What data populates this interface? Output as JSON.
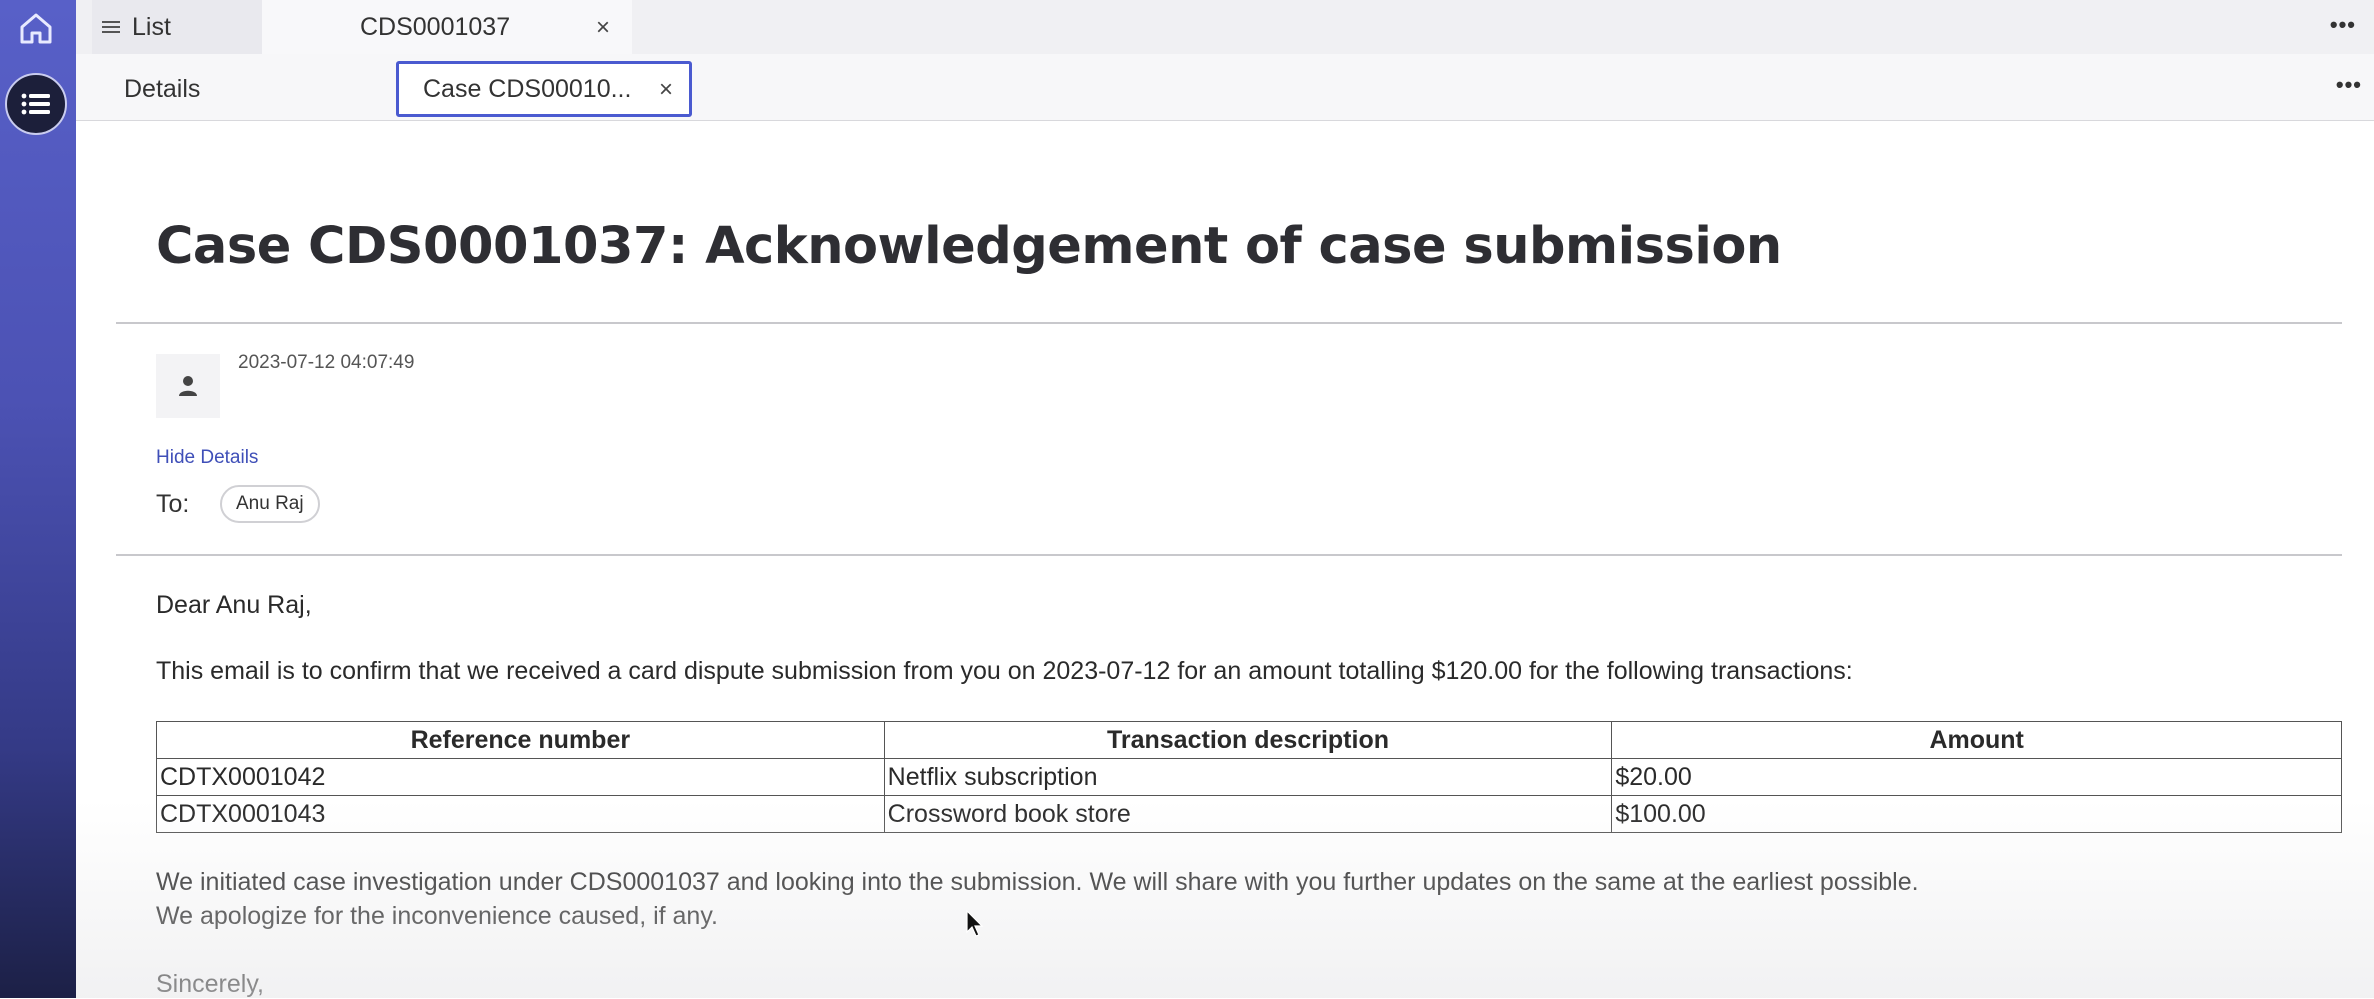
{
  "nav": {
    "home_icon": "home-icon",
    "menu_icon": "list-icon"
  },
  "top_tabs": {
    "list_label": "List",
    "case_label": "CDS0001037",
    "close_glyph": "×",
    "more": "•••"
  },
  "sub_tabs": {
    "details_label": "Details",
    "case_label": "Case CDS00010...",
    "close_glyph": "×",
    "more": "•••"
  },
  "email": {
    "title": "Case CDS0001037: Acknowledgement of case submission",
    "timestamp": "2023-07-12 04:07:49",
    "hide_details": "Hide Details",
    "to_label": "To:",
    "recipient": "Anu Raj",
    "greeting": "Dear Anu Raj,",
    "intro": "This email is to confirm that we received a card dispute submission from you on 2023-07-12 for an amount totalling $120.00 for the following transactions:",
    "table": {
      "headers": [
        "Reference number",
        "Transaction description",
        "Amount"
      ],
      "rows": [
        [
          "CDTX0001042",
          "Netflix subscription",
          "$20.00"
        ],
        [
          "CDTX0001043",
          "Crossword book store",
          "$100.00"
        ]
      ]
    },
    "body_line1": "We initiated case investigation under CDS0001037 and looking into the submission. We will share with you further updates on the same at the earliest possible.",
    "body_line2": "We apologize for the inconvenience caused, if any.",
    "signoff": "Sincerely,"
  },
  "colors": {
    "rail": "#4c52b4",
    "active_tab_border": "#4a5ad0",
    "link": "#3f4fb8"
  }
}
